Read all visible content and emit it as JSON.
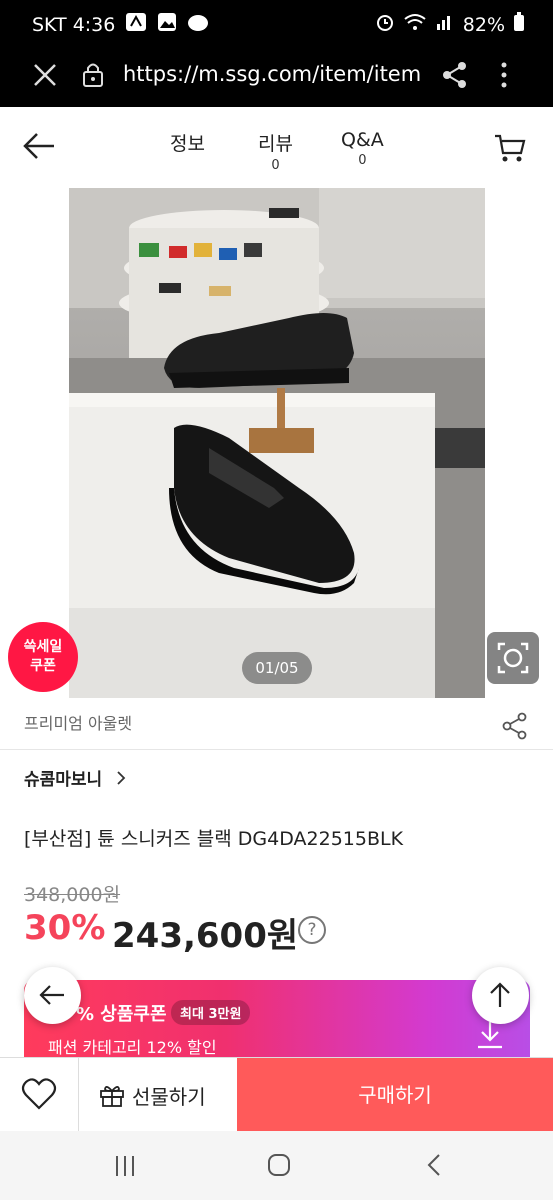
{
  "status_bar": {
    "carrier_time": "SKT 4:36",
    "battery": "82%",
    "icons": [
      "hotspot-icon",
      "gallery-icon",
      "cloud-icon",
      "alarm-icon",
      "wifi-icon",
      "signal-icon",
      "battery-icon"
    ]
  },
  "browser": {
    "url": "https://m.ssg.com/item/item"
  },
  "header": {
    "tabs": [
      {
        "label": "정보",
        "count": ""
      },
      {
        "label": "리뷰",
        "count": "0"
      },
      {
        "label": "Q&A",
        "count": "0"
      }
    ]
  },
  "gallery": {
    "counter": "01/05"
  },
  "badge": {
    "line1": "쓱세일",
    "line2": "쿠폰"
  },
  "store": {
    "label": "프리미엄 아울렛"
  },
  "product": {
    "brand": "슈콤마보니",
    "title": "[부산점] 튠 스니커즈 블랙 DG4DA22515BLK",
    "original_price": "348,000원",
    "discount": "30%",
    "price": "243,600원",
    "help": "?"
  },
  "coupon": {
    "title": "% 상품쿠폰",
    "max": "최대 3만원",
    "sub": "패션 카테고리 12% 할인"
  },
  "bottom": {
    "gift": "선물하기",
    "buy": "구매하기"
  },
  "colors": {
    "accent_red": "#f5445b",
    "buy_button": "#ff5a5a",
    "badge": "#ff1744"
  }
}
